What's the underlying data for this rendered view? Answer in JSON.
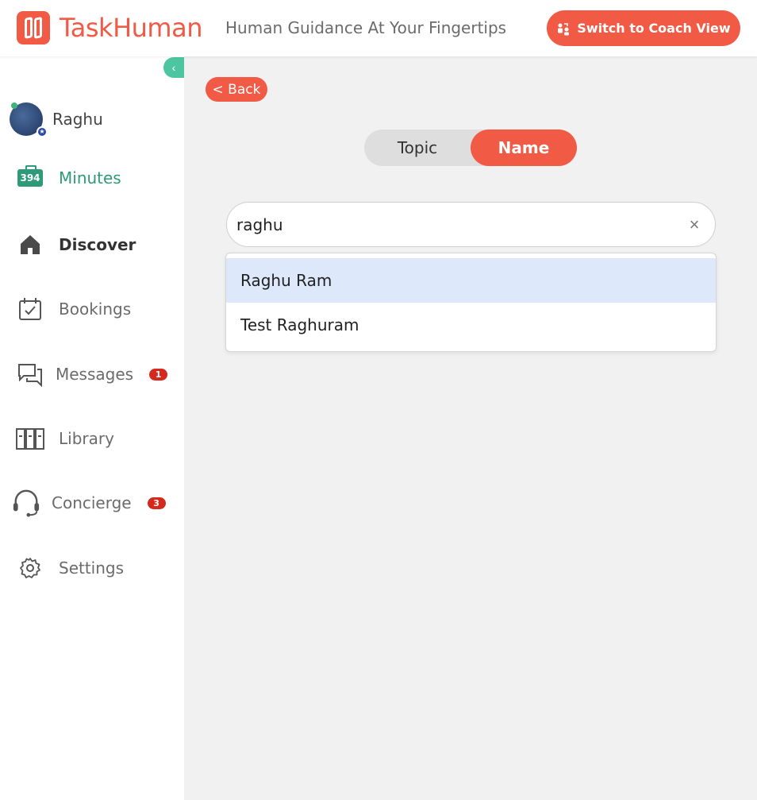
{
  "header": {
    "logo_text": "TaskHuman",
    "tagline": "Human Guidance At Your Fingertips",
    "coach_button": "Switch to Coach View"
  },
  "profile": {
    "name": "Raghu"
  },
  "nav": {
    "minutes_count": "394",
    "minutes": "Minutes",
    "discover": "Discover",
    "bookings": "Bookings",
    "messages": "Messages",
    "messages_badge": "1",
    "library": "Library",
    "concierge": "Concierge",
    "concierge_badge": "3",
    "settings": "Settings"
  },
  "main": {
    "back": "< Back",
    "toggle": {
      "topic": "Topic",
      "name": "Name",
      "selected": "Name"
    },
    "search_value": "raghu",
    "results": [
      "Raghu Ram",
      "Test Raghuram"
    ]
  },
  "colors": {
    "brand": "#f15a45",
    "accent_green": "#2e9a78",
    "highlight": "#dde8fb"
  }
}
